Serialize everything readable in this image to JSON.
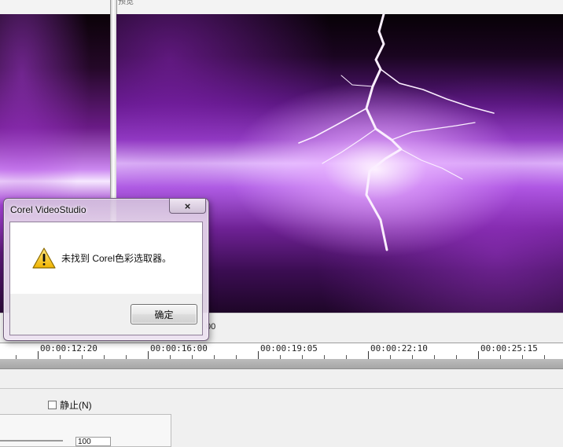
{
  "header": {
    "tiny_label": "预览"
  },
  "preview": {
    "end_timecode_fragment": "00"
  },
  "timeline": {
    "ruler_labels": [
      "00:00:12:20",
      "00:00:16:00",
      "00:00:19:05",
      "00:00:22:10",
      "00:00:25:15"
    ]
  },
  "options": {
    "still_label": "静止(N)",
    "spin_value": "100"
  },
  "dialog": {
    "title": "Corel VideoStudio",
    "close_glyph": "×",
    "icon": "warning-icon",
    "message": "未找到 Corel色彩选取器。",
    "ok_label": "确定"
  },
  "colors": {
    "preview_purple": "#8f3ec0",
    "dialog_border": "#6f5a7a"
  }
}
